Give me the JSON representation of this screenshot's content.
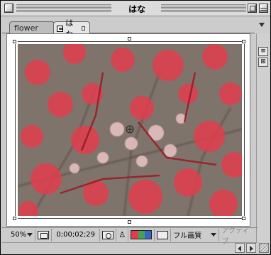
{
  "window": {
    "title": "はな"
  },
  "tabs": [
    {
      "label": "flower"
    },
    {
      "label": "はな"
    }
  ],
  "bottom_bar": {
    "zoom": "50%",
    "timecode": "0;00;02;29",
    "quality": "フル画質",
    "active_label": "アクティブ"
  },
  "colors": {
    "accent_red": "#e84a5a",
    "window_bg": "#cccccc"
  },
  "icons": {
    "close": "close-icon",
    "zoom": "zoom-box-icon",
    "collapse": "windowshade-icon",
    "composition": "composition-icon",
    "fit": "fit-to-window-icon",
    "snapshot": "camera-icon",
    "show_channel": "person-icon",
    "rgb": "rgb-channel-icon",
    "roi": "region-of-interest-icon"
  }
}
